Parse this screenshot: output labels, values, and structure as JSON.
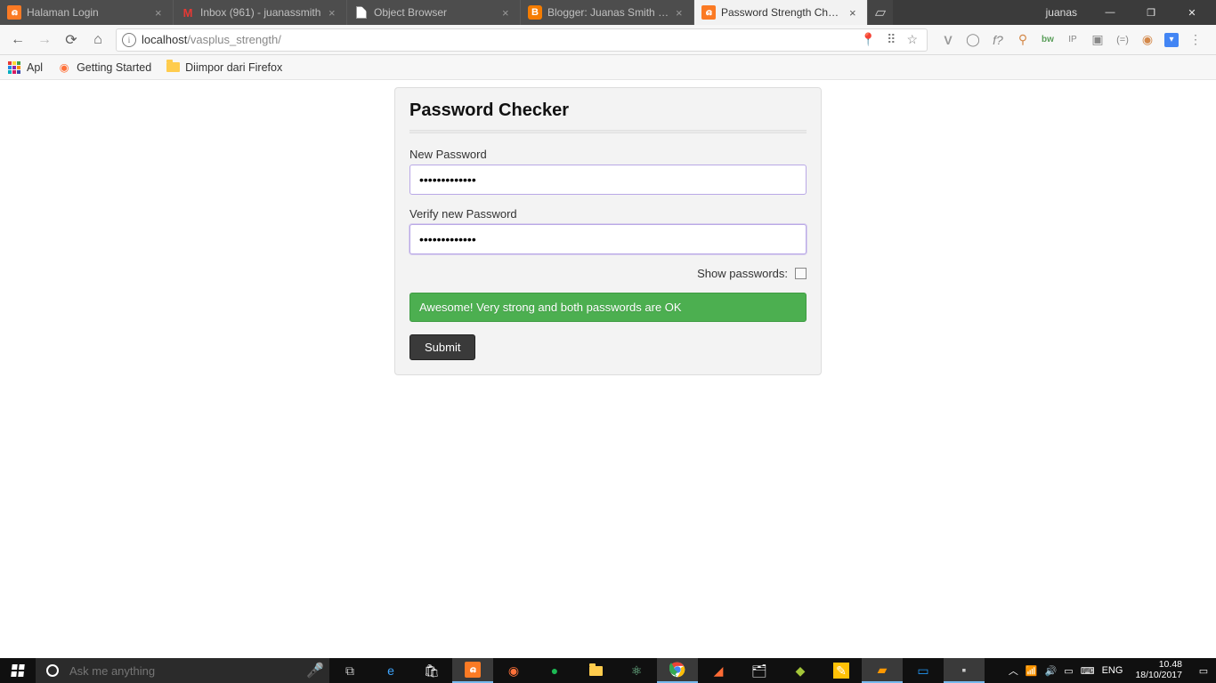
{
  "titlebar": {
    "tabs": [
      {
        "title": "Halaman Login"
      },
      {
        "title": "Inbox (961) - juanassmith"
      },
      {
        "title": "Object Browser"
      },
      {
        "title": "Blogger: Juanas Smith Sh"
      },
      {
        "title": "Password Strength Check"
      }
    ],
    "profile": "juanas"
  },
  "omnibox": {
    "host": "localhost",
    "path": "/vasplus_strength/"
  },
  "ext": {
    "f": "f?",
    "bw": "bw",
    "ip": "IP"
  },
  "bookmarks": {
    "apps": "Apl",
    "getting_started": "Getting Started",
    "firefox_import": "Diimpor dari Firefox"
  },
  "form": {
    "heading": "Password Checker",
    "new_password_label": "New Password",
    "new_password_value": "•••••••••••••",
    "verify_label": "Verify new Password",
    "verify_value": "•••••••••••••",
    "show_label": "Show passwords:",
    "alert": "Awesome! Very strong and both passwords are OK",
    "submit": "Submit"
  },
  "taskbar": {
    "cortana": "Ask me anything",
    "lang": "ENG",
    "time": "10.48",
    "date": "18/10/2017"
  }
}
